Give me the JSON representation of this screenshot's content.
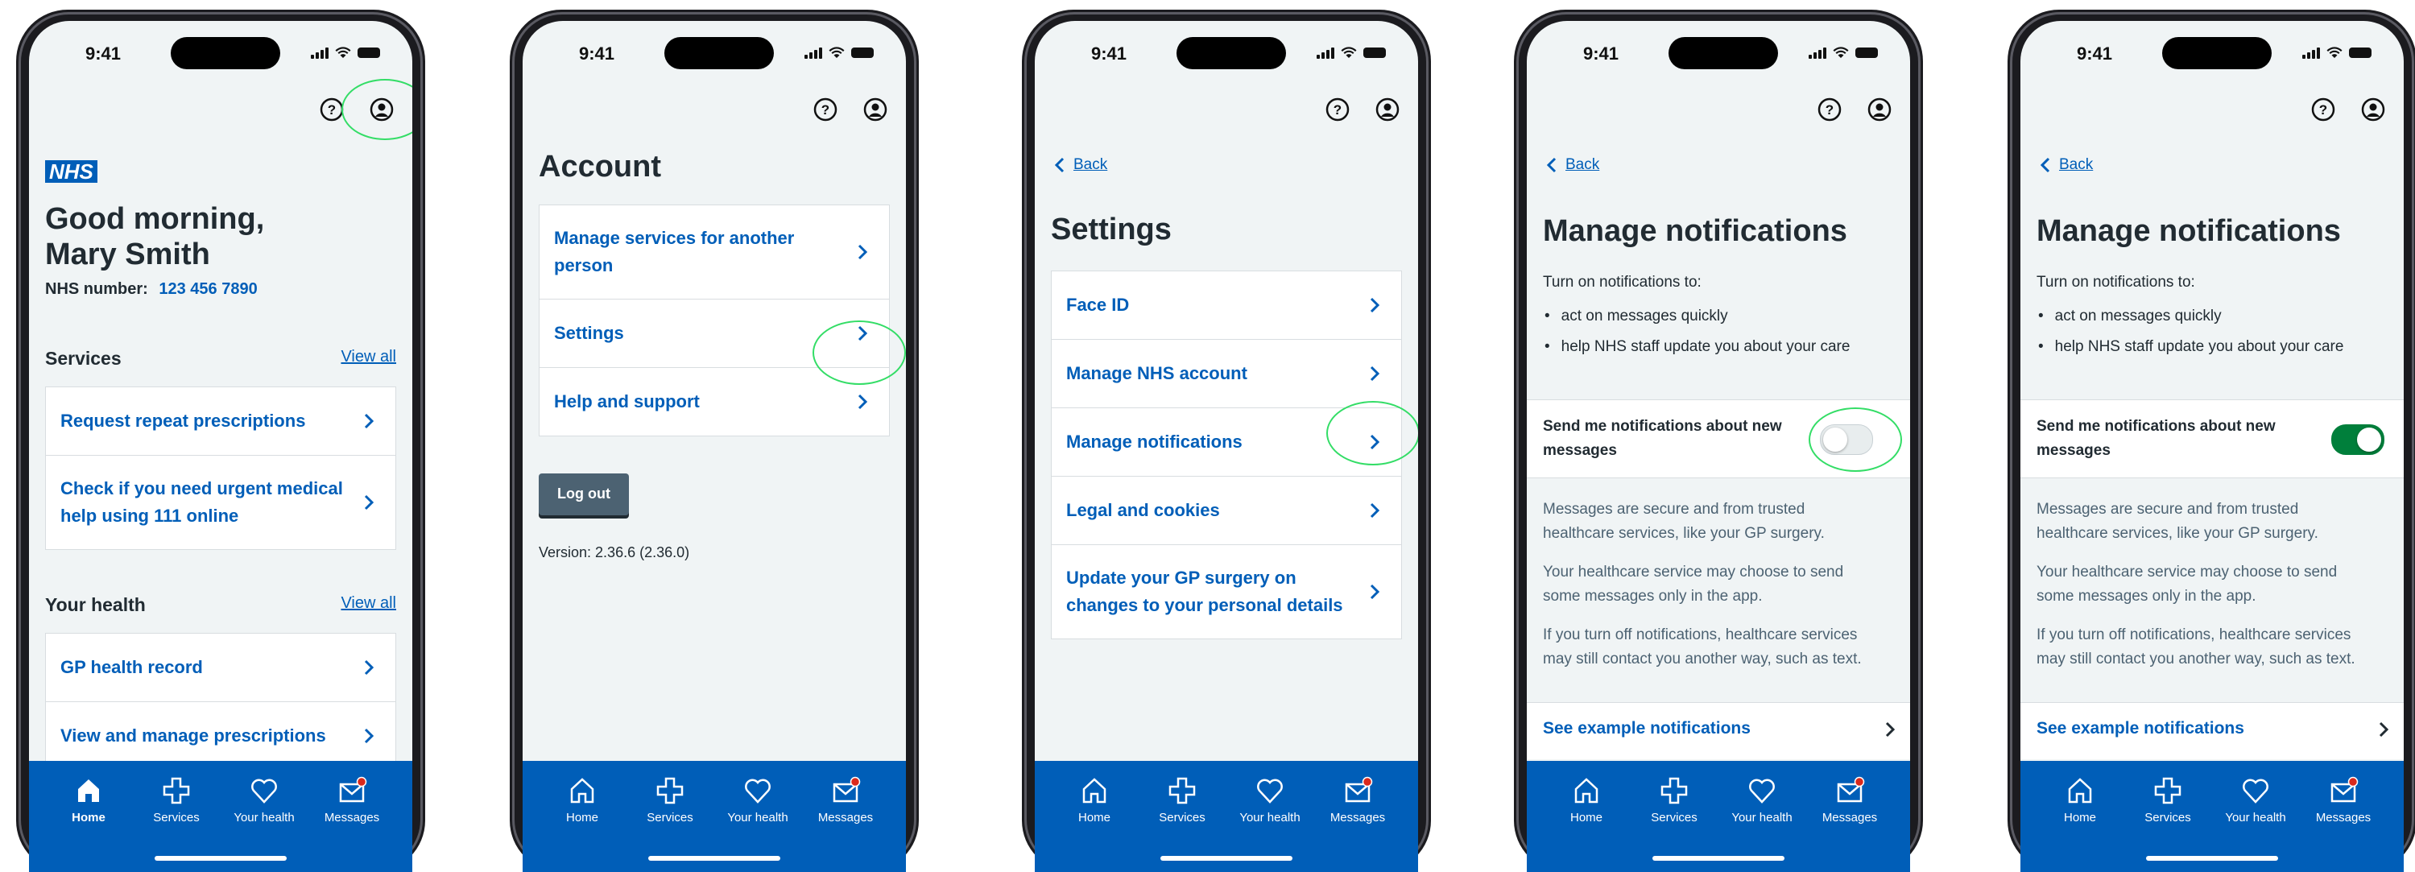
{
  "status": {
    "time": "9:41"
  },
  "tabs": [
    {
      "label": "Home",
      "icon": "home-icon"
    },
    {
      "label": "Services",
      "icon": "cross-icon"
    },
    {
      "label": "Your health",
      "icon": "heart-icon"
    },
    {
      "label": "Messages",
      "icon": "envelope-icon"
    }
  ],
  "screen1": {
    "logo": "NHS",
    "greeting_line1": "Good morning,",
    "greeting_line2": "Mary Smith",
    "nhs_label": "NHS number:",
    "nhs_number": "123 456 7890",
    "services_heading": "Services",
    "view_all": "View all",
    "services": [
      "Request repeat prescriptions",
      "Check if you need urgent medical help using 111 online"
    ],
    "health_heading": "Your health",
    "health": [
      "GP health record",
      "View and manage prescriptions"
    ]
  },
  "screen2": {
    "title": "Account",
    "items": [
      "Manage services for another person",
      "Settings",
      "Help and support"
    ],
    "logout": "Log out",
    "version": "Version: 2.36.6 (2.36.0)"
  },
  "screen3": {
    "back": "Back",
    "title": "Settings",
    "items": [
      "Face ID",
      "Manage NHS account",
      "Manage notifications",
      "Legal and cookies",
      "Update your GP surgery on changes to your personal details"
    ]
  },
  "notifications": {
    "back": "Back",
    "title": "Manage notifications",
    "intro": "Turn on notifications to:",
    "bullets": [
      "act on messages quickly",
      "help NHS staff update you about your care"
    ],
    "toggle_label": "Send me notifications about new messages",
    "para1": "Messages are secure and from trusted healthcare services, like your GP surgery.",
    "para2": "Your healthcare service may choose to send some messages only in the app.",
    "para3": "If you turn off notifications, healthcare services may still contact you another way, such as text.",
    "example_link": "See example notifications"
  },
  "colors": {
    "nhs_blue": "#005eb8",
    "highlight": "#33dd66",
    "toggle_on": "#007f3b",
    "toggle_off": "#e8edee"
  },
  "toggle_states": {
    "screen4": false,
    "screen5": true
  }
}
